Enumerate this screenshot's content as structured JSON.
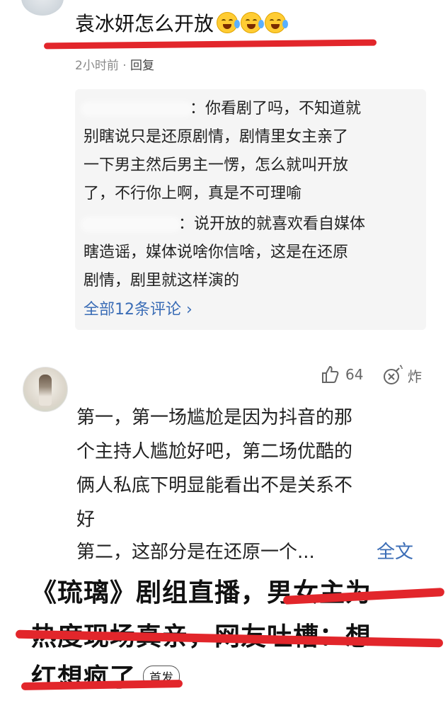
{
  "comment1": {
    "text": "袁冰妍怎么开放",
    "emojis": [
      "laugh-cry-emoji",
      "laugh-cry-emoji",
      "laugh-cry-emoji"
    ],
    "time": "2小时前",
    "separator": "·",
    "reply_label": "回复"
  },
  "replies": {
    "reply1_lines": [
      "：你看剧了吗，不知道就",
      "别瞎说只是还原剧情，剧情里女主亲了",
      "一下男主然后男主一愣，怎么就叫开放",
      "了，不行你上啊，真是不可理喻"
    ],
    "reply2_lines": [
      "：说开放的就喜欢看自媒体",
      "瞎造谣，媒体说啥你信啥，这是在还原",
      "剧情，剧里就这样演的"
    ],
    "all_comments": "全部12条评论 ›"
  },
  "comment2": {
    "like_count": "64",
    "bomb_label": "炸",
    "lines": [
      "第一，第一场尴尬是因为抖音的那",
      "个主持人尴尬好吧，第二场优酷的",
      "俩人私底下明显能看出不是关系不",
      "好",
      "第二，这部分是在还原一个..."
    ],
    "full_text": "全文"
  },
  "headline": {
    "lines": [
      "《琉璃》剧组直播，男女主为",
      "热度现场真亲，网友吐槽：想",
      "红想疯了"
    ],
    "tag": "首发"
  },
  "colors": {
    "accent_link": "#3b6db6",
    "red_underline": "#e2262b",
    "reply_bg": "#f5f5f5"
  }
}
